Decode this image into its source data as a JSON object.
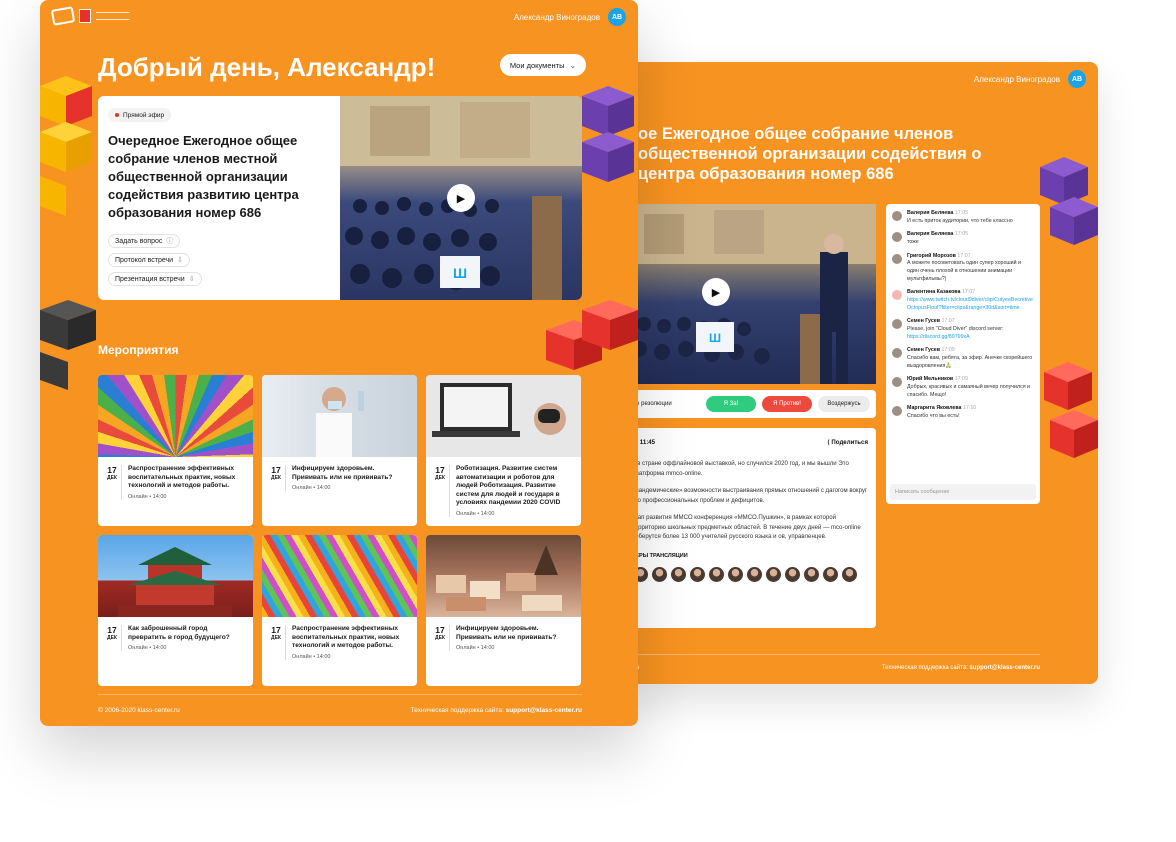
{
  "colors": {
    "brand": "#f79321",
    "accent_blue": "#1aa3e8",
    "live": "#e5322d",
    "yes": "#2fcb7e",
    "no": "#ec4a3c"
  },
  "user": {
    "name": "Александр Виноградов",
    "initials": "АВ"
  },
  "front": {
    "greeting": "Добрый день, Александр!",
    "docs_button": "Мои документы",
    "hero": {
      "badge": "Прямой эфир",
      "title": "Очередное Ежегодное общее собрание членов местной общественной организации содействия развитию центра образования номер 686",
      "actions": [
        "Задать вопрос",
        "Протокол встречи",
        "Презентация встречи"
      ]
    },
    "events_title": "Мероприятия",
    "events": [
      {
        "day": "17",
        "month": "ДЕК",
        "title": "Распространение эффективных воспитательных практик, новых технологий и методов работы.",
        "meta": "Онлайн • 14:00"
      },
      {
        "day": "17",
        "month": "ДЕК",
        "title": "Инфицируем здоровьем. Прививать или не прививать?",
        "meta": "Онлайн • 14:00"
      },
      {
        "day": "17",
        "month": "ДЕК",
        "title": "Роботизация. Развитие систем автоматизации и роботов для людей Роботизация. Развитие систем для людей и государя в условиях пандемии 2020 COVID",
        "meta": "Онлайн • 14:00"
      },
      {
        "day": "17",
        "month": "ДЕК",
        "title": "Как заброшенный город превратить в город будущего?",
        "meta": "Онлайн • 14:00"
      },
      {
        "day": "17",
        "month": "ДЕК",
        "title": "Распространение эффективных воспитательных практик, новых технологий и методов работы.",
        "meta": "Онлайн • 14:00"
      },
      {
        "day": "17",
        "month": "ДЕК",
        "title": "Инфицируем здоровьем. Прививать или не прививать?",
        "meta": "Онлайн • 14:00"
      }
    ],
    "copyright": "© 2006-2020 klass-center.ru",
    "support_label": "Техническая поддержка сайта:",
    "support_email": "support@klass-center.ru"
  },
  "back": {
    "title": "ое Ежегодное общее собрание членов общественной организации содействия о центра образования номер 686",
    "vote_label": "тие резолюции",
    "vote_yes": "Я За!",
    "vote_no": "Я Против!",
    "vote_abstain": "Воздержусь",
    "time": "— 11:45",
    "share": "Поделиться",
    "paragraphs": [
      "й в стране оффлайновой выставкой, но случился 2020 год, и мы вышли Это платформа mmco-online.",
      "«пандемические» возможности выстраивания прямых отношений с дагогом вокруг его профессиональных проблем и дефицитов.",
      "этап развития ММСО конференция «ММСО.Пушкин», в рамках которой территорию школьных предметных областей. В течение двух дней — mco-online соберутся более 13 000 учителей русского языка и ов, управленцев."
    ],
    "speakers_label": "КЕРЫ ТРАНСЛЯЦИИ",
    "speakers_count": 12,
    "chat": [
      {
        "name": "Валерия Беляева",
        "time": "17:05",
        "text": "И есть приток аудитории, что тебе классно"
      },
      {
        "name": "Валерия Беляева",
        "time": "17:05",
        "text": "тоже"
      },
      {
        "name": "Григорий Морозов",
        "time": "17:07",
        "text": "А можете посоветовать один супер хороший и один очень плохой в отношении анимации мультфильмы?)"
      },
      {
        "name": "Валентина Казакова",
        "time": "17:07",
        "text": "",
        "link": "https://www.twitch.tv/cloud9diver/clip/CutyeeBecretiveOctopusFloof?filter=clips&range=30d&sort=time"
      },
      {
        "name": "Семен Гусев",
        "time": "17:07",
        "text": "Please, join \"Cloud Diver\" discord server:",
        "link": "https://discord.gg/89799xA"
      },
      {
        "name": "Семен Гусев",
        "time": "17:09",
        "text": "Спасибо вам, ребята, за эфир. Анечке скорейшего выздоровления🙏"
      },
      {
        "name": "Юрий Мельников",
        "time": "17:09",
        "text": "Добрых, красивых и самаяный вечер получился и спасибо. Мещо!"
      },
      {
        "name": "Маргарита Яковлева",
        "time": "17:10",
        "text": "Спасибо что вы есть!"
      }
    ],
    "chat_placeholder": "Написать сообщение",
    "support_label": "Техническая поддержка сайта:",
    "support_email": "support@klass-center.ru",
    "footer_left": "ru"
  }
}
